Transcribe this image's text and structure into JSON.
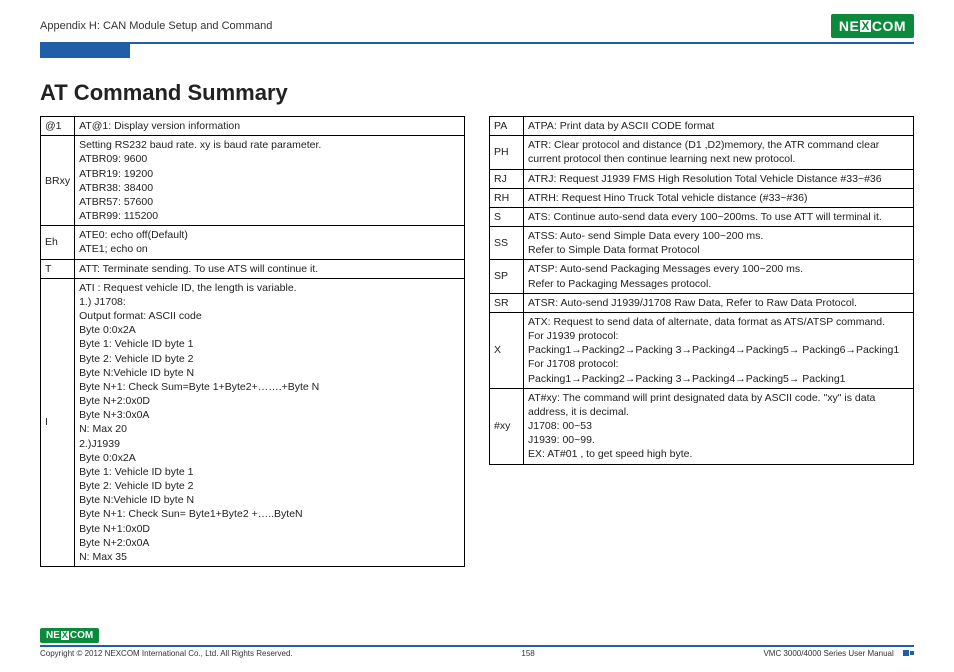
{
  "header": {
    "breadcrumb": "Appendix H: CAN Module Setup and Command",
    "brand": "NEXCOM"
  },
  "title": "AT Command Summary",
  "left_rows": [
    {
      "code": "@1",
      "desc": "AT@1: Display version information"
    },
    {
      "code": "BRxy",
      "desc": "Setting RS232 baud rate. xy is baud rate parameter.\nATBR09: 9600\nATBR19: 19200\nATBR38: 38400\nATBR57: 57600\nATBR99: 115200"
    },
    {
      "code": "Eh",
      "desc": "ATE0: echo off(Default)\nATE1; echo on"
    },
    {
      "code": "T",
      "desc": "ATT: Terminate sending. To use ATS will continue it."
    },
    {
      "code": "I",
      "desc": "ATI : Request vehicle ID, the length is variable.\n1.) J1708:\nOutput format: ASCII code\nByte 0:0x2A\nByte 1: Vehicle ID byte 1\nByte 2: Vehicle ID byte 2\nByte N:Vehicle ID byte N\nByte N+1: Check Sum=Byte 1+Byte2+…….+Byte N\nByte N+2:0x0D\nByte N+3:0x0A\nN: Max 20\n2.)J1939\nByte 0:0x2A\nByte 1: Vehicle ID byte 1\nByte 2: Vehicle ID byte 2\nByte N:Vehicle ID byte N\nByte N+1: Check Sun= Byte1+Byte2 +…..ByteN\nByte N+1:0x0D\nByte N+2:0x0A\nN: Max 35"
    }
  ],
  "right_rows": [
    {
      "code": "PA",
      "desc": "ATPA: Print data by ASCII CODE format"
    },
    {
      "code": "PH",
      "desc": "ATR: Clear protocol and distance (D1 ,D2)memory, the ATR command clear current protocol then continue learning next new protocol."
    },
    {
      "code": "RJ",
      "desc": "ATRJ: Request J1939 FMS High Resolution Total Vehicle Distance #33~#36"
    },
    {
      "code": "RH",
      "desc": "ATRH: Request Hino Truck Total vehicle distance (#33~#36)"
    },
    {
      "code": "S",
      "desc": "ATS: Continue auto-send data every 100~200ms. To use ATT will terminal it."
    },
    {
      "code": "SS",
      "desc": "ATSS: Auto- send Simple Data every 100~200 ms.\nRefer to Simple Data format Protocol"
    },
    {
      "code": "SP",
      "desc": "ATSP: Auto-send Packaging Messages every 100~200 ms.\nRefer to Packaging Messages protocol."
    },
    {
      "code": "SR",
      "desc": "ATSR: Auto-send J1939/J1708 Raw Data, Refer to Raw Data Protocol."
    },
    {
      "code": "X",
      "desc": "ATX: Request to send data of alternate, data format as ATS/ATSP command.\nFor J1939 protocol:\nPacking1→Packing2→Packing 3→Packing4→Packing5→ Packing6→Packing1\nFor J1708 protocol:\nPacking1→Packing2→Packing 3→Packing4→Packing5→ Packing1"
    },
    {
      "code": "#xy",
      "desc": "AT#xy: The command will print designated data by ASCII code. \"xy\" is data address, it is decimal.\nJ1708: 00~53\nJ1939: 00~99.\nEX: AT#01 , to get speed high byte."
    }
  ],
  "footer": {
    "copyright": "Copyright © 2012 NEXCOM International Co., Ltd. All Rights Reserved.",
    "page": "158",
    "doc": "VMC 3000/4000 Series User Manual"
  }
}
